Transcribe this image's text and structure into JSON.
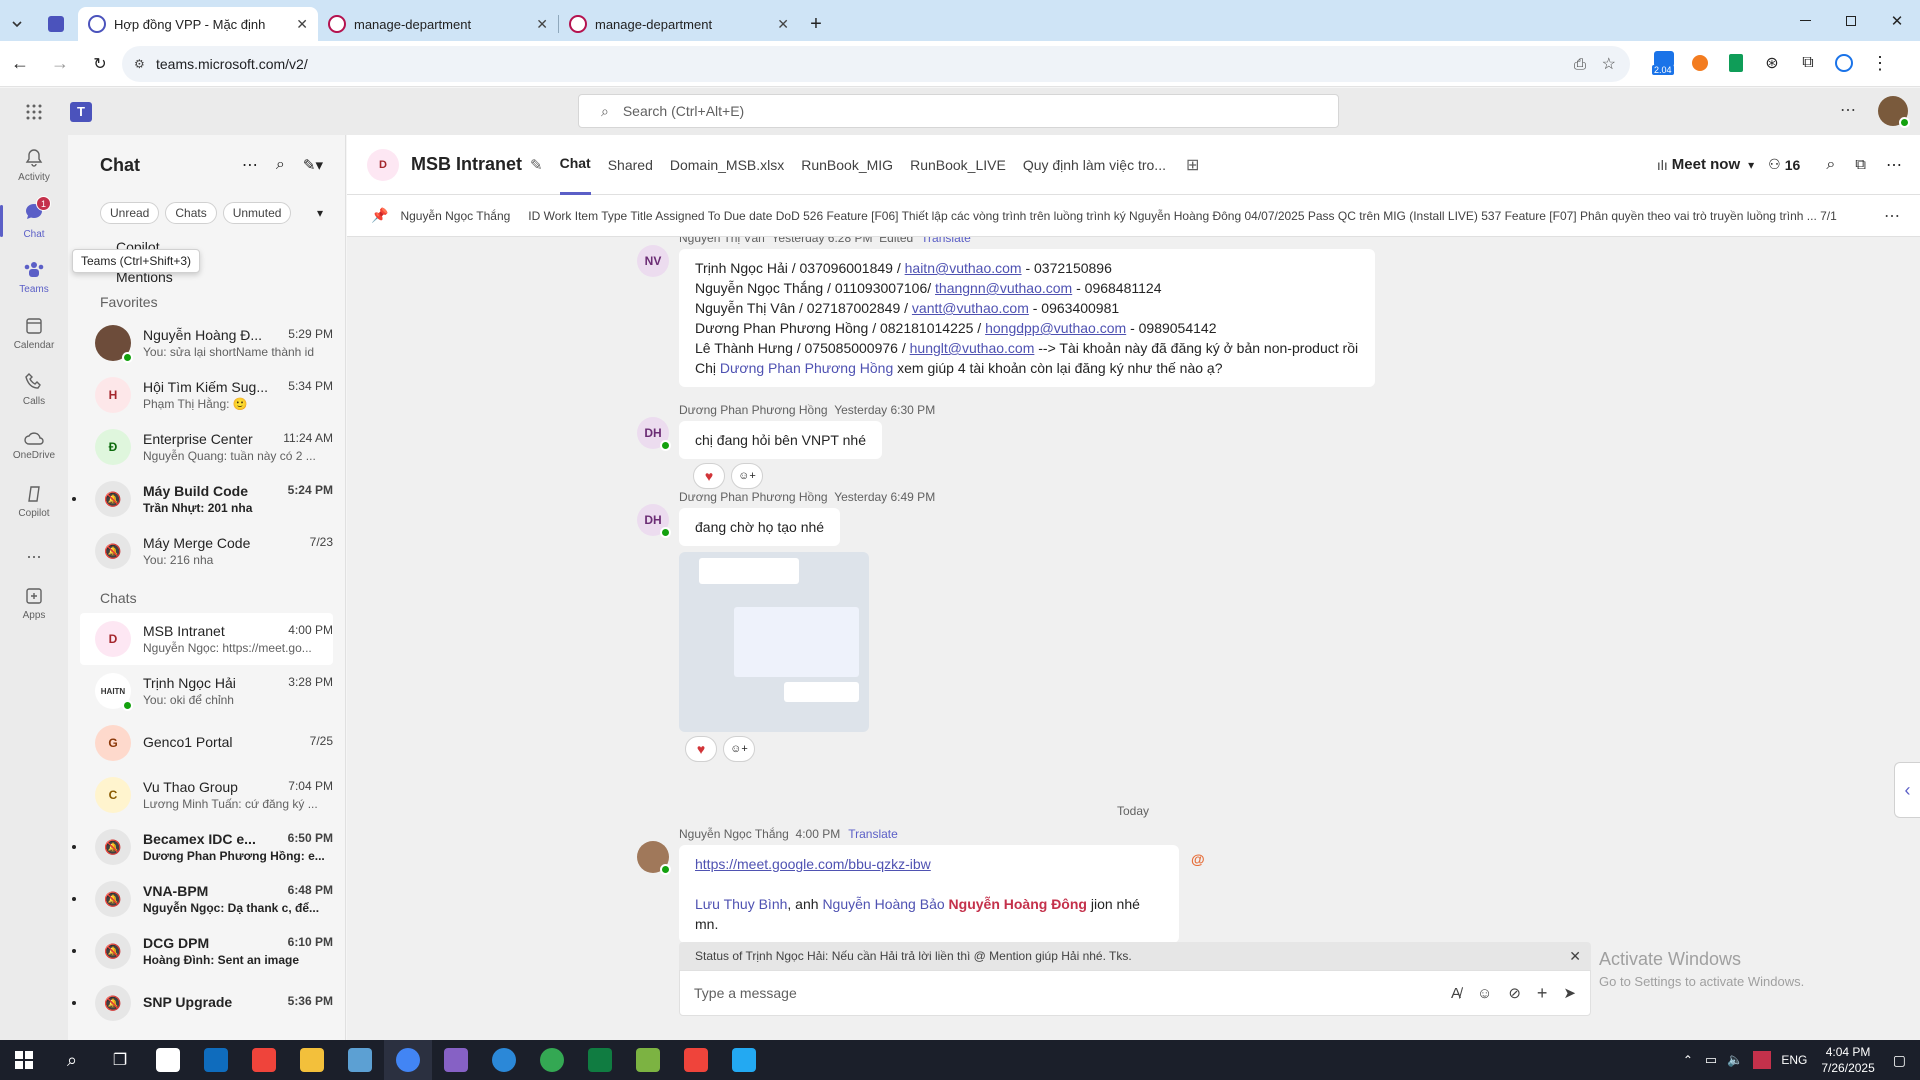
{
  "browser": {
    "tabs": [
      {
        "title": "Hợp đồng VPP - Mặc định",
        "active": true
      },
      {
        "title": "manage-department",
        "active": false
      },
      {
        "title": "manage-department",
        "active": false
      }
    ],
    "url": "teams.microsoft.com/v2/",
    "extension_badge": "2.04"
  },
  "header": {
    "search_placeholder": "Search (Ctrl+Alt+E)"
  },
  "rail": {
    "items": [
      {
        "label": "Activity",
        "icon": "bell-icon"
      },
      {
        "label": "Chat",
        "icon": "chat-icon",
        "badge": "1",
        "selected": true
      },
      {
        "label": "Teams",
        "icon": "teams-icon"
      },
      {
        "label": "Calendar",
        "icon": "calendar-icon"
      },
      {
        "label": "Calls",
        "icon": "phone-icon"
      },
      {
        "label": "OneDrive",
        "icon": "cloud-icon"
      },
      {
        "label": "Copilot",
        "icon": "copilot-icon"
      },
      {
        "label": "...",
        "icon": "more-icon"
      },
      {
        "label": "Apps",
        "icon": "apps-icon"
      }
    ],
    "tooltip": "Teams (Ctrl+Shift+3)"
  },
  "chatlist": {
    "title": "Chat",
    "filters": [
      "Unread",
      "Chats",
      "Unmuted"
    ],
    "pinned_partial": [
      "Copilot",
      "Mentions"
    ],
    "favorites_label": "Favorites",
    "favorites": [
      {
        "name": "Nguyễn Hoàng Đ...",
        "time": "5:29 PM",
        "preview": "You:  sửa lại shortName thành id",
        "avatar": "photo",
        "bold": false
      },
      {
        "name": "Hội Tìm Kiếm Sug...",
        "time": "5:34 PM",
        "preview": "Phạm Thị Hằng: 🙂",
        "avatar": "H",
        "bold": false
      },
      {
        "name": "Enterprise Center",
        "time": "11:24 AM",
        "preview": "Nguyễn Quang: tuần này có 2 ...",
        "avatar": "Đ",
        "bold": false
      },
      {
        "name": "Máy Build Code",
        "time": "5:24 PM",
        "preview": "Trần Nhựt: 201 nha",
        "avatar": "muted",
        "bold": true
      },
      {
        "name": "Máy Merge Code",
        "time": "7/23",
        "preview": "You: 216  nha",
        "avatar": "muted",
        "bold": false
      }
    ],
    "chats_label": "Chats",
    "chats": [
      {
        "name": "MSB Intranet",
        "time": "4:00 PM",
        "preview": "Nguyễn Ngọc: https://meet.go...",
        "avatar": "D",
        "bold": false,
        "selected": true
      },
      {
        "name": "Trịnh Ngọc Hải",
        "time": "3:28 PM",
        "preview": "You: oki để chỉnh",
        "avatar": "HAITN",
        "bold": false
      },
      {
        "name": "Genco1 Portal",
        "time": "7/25",
        "preview": "",
        "avatar": "G",
        "bold": false
      },
      {
        "name": "Vu Thao Group",
        "time": "7:04 PM",
        "preview": "Lương Minh Tuấn: cứ đăng ký ...",
        "avatar": "C",
        "bold": false
      },
      {
        "name": "Becamex IDC e...",
        "time": "6:50 PM",
        "preview": "Dương Phan Phương Hồng: e...",
        "avatar": "muted",
        "bold": true
      },
      {
        "name": "VNA-BPM",
        "time": "6:48 PM",
        "preview": "Nguyễn Ngọc: Dạ thank c, để...",
        "avatar": "muted",
        "bold": true
      },
      {
        "name": "DCG DPM",
        "time": "6:10 PM",
        "preview": "Hoàng Đình: Sent an image",
        "avatar": "muted",
        "bold": true
      },
      {
        "name": "SNP Upgrade",
        "time": "5:36 PM",
        "preview": "",
        "avatar": "muted",
        "bold": true
      }
    ]
  },
  "conversation": {
    "title": "MSB Intranet",
    "tabs": [
      "Chat",
      "Shared",
      "Domain_MSB.xlsx",
      "RunBook_MIG",
      "RunBook_LIVE",
      "Quy định làm việc tro..."
    ],
    "meet_now": "Meet now",
    "participants": "16",
    "pinned_author": "Nguyễn Ngọc Thắng",
    "pinned_text": "ID Work Item Type Title Assigned To Due date DoD 526 Feature [F06] Thiết lập các vòng trình trên luồng trình ký Nguyễn Hoàng Đông 04/07/2025 Pass QC trên MIG (Install LIVE) 537 Feature [F07] Phân quyền theo vai trò truyền luồng trình ... 7/1",
    "messages": [
      {
        "author": "Nguyễn Thị Vân",
        "time": "Yesterday 6:28 PM",
        "edited": "Edited",
        "translate": "Translate",
        "initials": "NV",
        "lines": [
          [
            "Trịnh Ngọc Hải / 037096001849 / ",
            "haitn@vuthao.com",
            " - 0372150896"
          ],
          [
            "Nguyễn Ngọc Thắng / 011093007106/ ",
            "thangnn@vuthao.com",
            " - 0968481124"
          ],
          [
            "Nguyễn Thị Vân / 027187002849 /  ",
            "vantt@vuthao.com",
            " - 0963400981"
          ],
          [
            "Dương Phan Phương Hồng / 082181014225 / ",
            "hongdpp@vuthao.com",
            " - 0989054142"
          ],
          [
            "Lê Thành Hưng / 075085000976 / ",
            "hunglt@vuthao.com",
            " --> Tài khoản này đã đăng ký ở bản non-product rồi"
          ]
        ],
        "last_line_pre": "Chị ",
        "last_line_mention": "Dương Phan Phương Hồng",
        "last_line_post": " xem giúp 4 tài khoản còn lại đăng ký như thế nào ạ?"
      },
      {
        "author": "Dương Phan Phương Hồng",
        "time": "Yesterday 6:30 PM",
        "initials": "DH",
        "text": "chị đang hỏi bên VNPT nhé"
      },
      {
        "author": "Dương Phan Phương Hồng",
        "time": "Yesterday 6:49 PM",
        "initials": "DH",
        "text": "đang chờ họ tạo nhé"
      },
      {
        "author": "Nguyễn Ngọc Thắng",
        "time": "4:00 PM",
        "translate": "Translate",
        "link": "https://meet.google.com/bbu-qzkz-ibw",
        "m1": "Lưu Thuy Bình",
        "sep": ", anh ",
        "m2": "Nguyễn Hoàng Bảo",
        "m3": "Nguyễn Hoàng Đông",
        "post": " jion nhé mn."
      }
    ],
    "day_divider": "Today",
    "status_banner": "Status of Trịnh Ngọc Hải: Nếu cần Hải trả lời liền thì @ Mention giúp Hải nhé. Tks.",
    "composer_placeholder": "Type a message"
  },
  "watermark": {
    "line1": "Activate Windows",
    "line2": "Go to Settings to activate Windows."
  },
  "taskbar": {
    "time": "4:04 PM",
    "date": "7/26/2025",
    "lang": "ENG"
  }
}
